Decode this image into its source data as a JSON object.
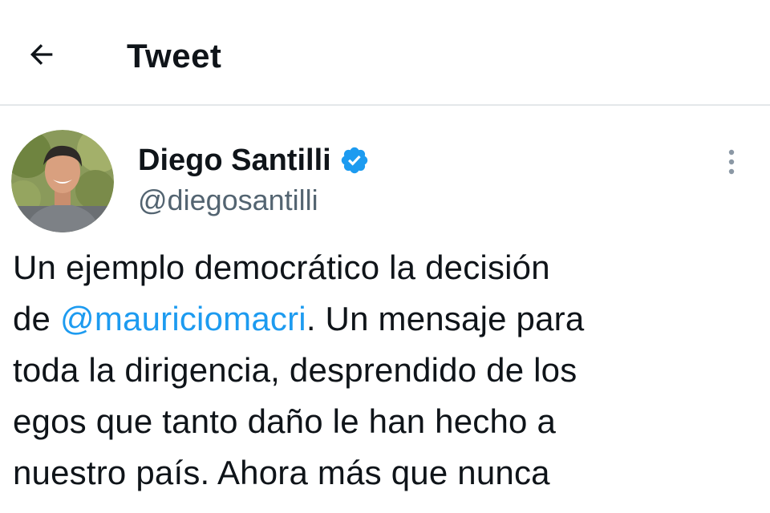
{
  "header": {
    "title": "Tweet",
    "back_icon": "arrow-left-icon"
  },
  "tweet": {
    "author": {
      "display_name": "Diego Santilli",
      "handle": "@diegosantilli",
      "verified": true,
      "verified_color": "#1d9bf0"
    },
    "more_icon": "more-vertical-icon",
    "text_lines": [
      {
        "before": "Un ejemplo democrático la decisión",
        "mention": "",
        "after": ""
      },
      {
        "before": "de ",
        "mention": "@mauriciomacri",
        "after": ". Un mensaje para"
      },
      {
        "before": "toda la dirigencia, desprendido de los",
        "mention": "",
        "after": ""
      },
      {
        "before": "egos que tanto daño le han hecho a",
        "mention": "",
        "after": ""
      },
      {
        "before": "nuestro país. Ahora más que nunca",
        "mention": "",
        "after": ""
      }
    ]
  },
  "colors": {
    "text": "#0f1419",
    "secondary": "#536471",
    "link": "#1d9bf0",
    "divider": "#e4e7ea"
  }
}
